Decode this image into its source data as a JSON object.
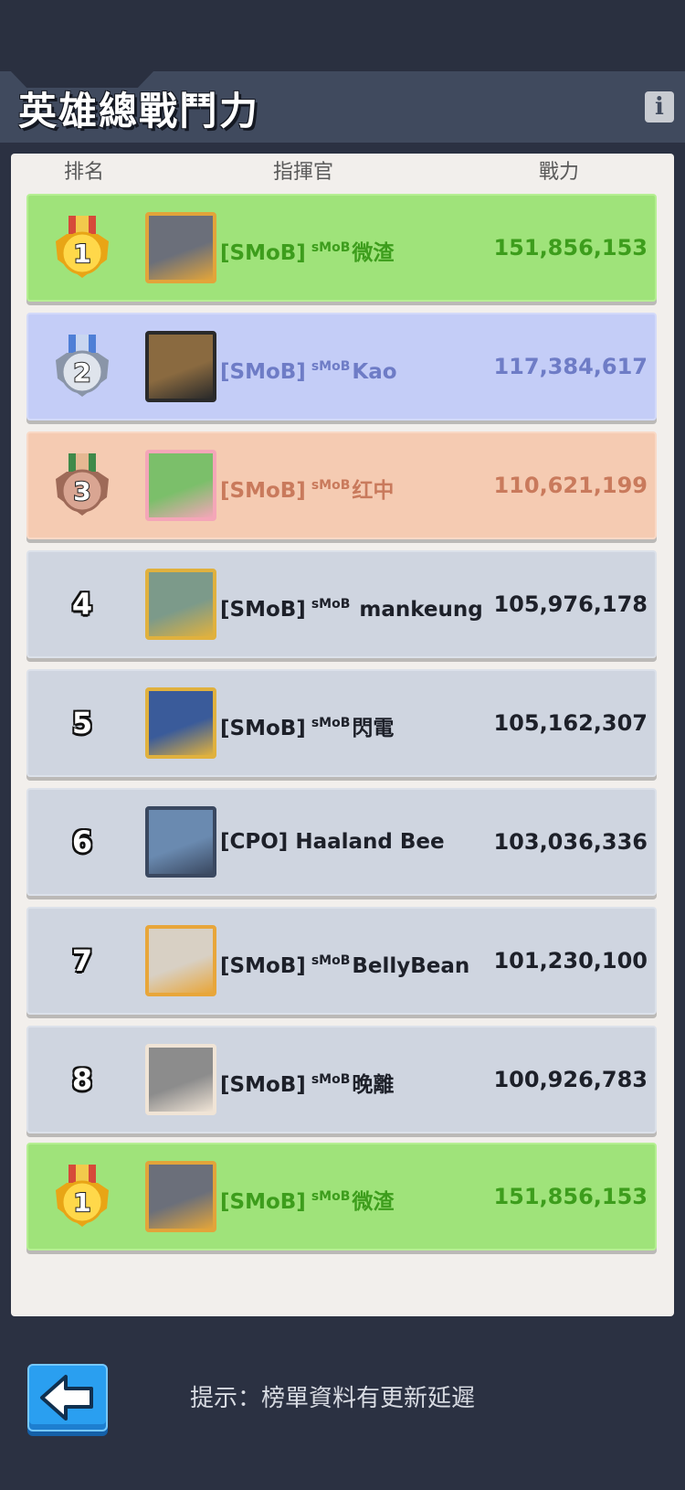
{
  "title": "英雄總戰鬥力",
  "columns": {
    "rank": "排名",
    "commander": "指揮官",
    "power": "戰力"
  },
  "rows": [
    {
      "rank": "1",
      "tier": "gold",
      "tag": "[SMoB]",
      "sup": "sMoB",
      "name": "微渣",
      "power": "151,856,153"
    },
    {
      "rank": "2",
      "tier": "silver",
      "tag": "[SMoB]",
      "sup": "sMoB",
      "name": "Kao",
      "power": "117,384,617"
    },
    {
      "rank": "3",
      "tier": "bronze",
      "tag": "[SMoB]",
      "sup": "sMoB",
      "name": "红中",
      "power": "110,621,199"
    },
    {
      "rank": "4",
      "tier": "normal",
      "tag": "[SMoB]",
      "sup": "sMoB",
      "name": " mankeung",
      "power": "105,976,178"
    },
    {
      "rank": "5",
      "tier": "normal",
      "tag": "[SMoB]",
      "sup": "sMoB",
      "name": "閃電",
      "power": "105,162,307"
    },
    {
      "rank": "6",
      "tier": "normal",
      "tag": "[CPO]",
      "sup": "",
      "name": "Haaland Bee",
      "power": "103,036,336"
    },
    {
      "rank": "7",
      "tier": "normal",
      "tag": "[SMoB]",
      "sup": "sMoB",
      "name": "BellyBean",
      "power": "101,230,100"
    },
    {
      "rank": "8",
      "tier": "normal",
      "tag": "[SMoB]",
      "sup": "sMoB",
      "name": "晚離",
      "power": "100,926,783"
    }
  ],
  "my_rank": {
    "rank": "1",
    "tier": "gold",
    "tag": "[SMoB]",
    "sup": "sMoB",
    "name": "微渣",
    "power": "151,856,153"
  },
  "hint": "提示：榜單資料有更新延遲",
  "colors": {
    "gold_row": "#9fe37a",
    "silver_row": "#c4cdf7",
    "bronze_row": "#f5cbb2",
    "normal_row": "#cfd5e0",
    "gold_text": "#3d9d1c",
    "silver_text": "#6e7cc6",
    "bronze_text": "#c97a5c"
  },
  "icons": {
    "info": "info-icon",
    "back": "back-arrow-icon",
    "medals": [
      "gold-medal-icon",
      "silver-medal-icon",
      "bronze-medal-icon"
    ]
  }
}
